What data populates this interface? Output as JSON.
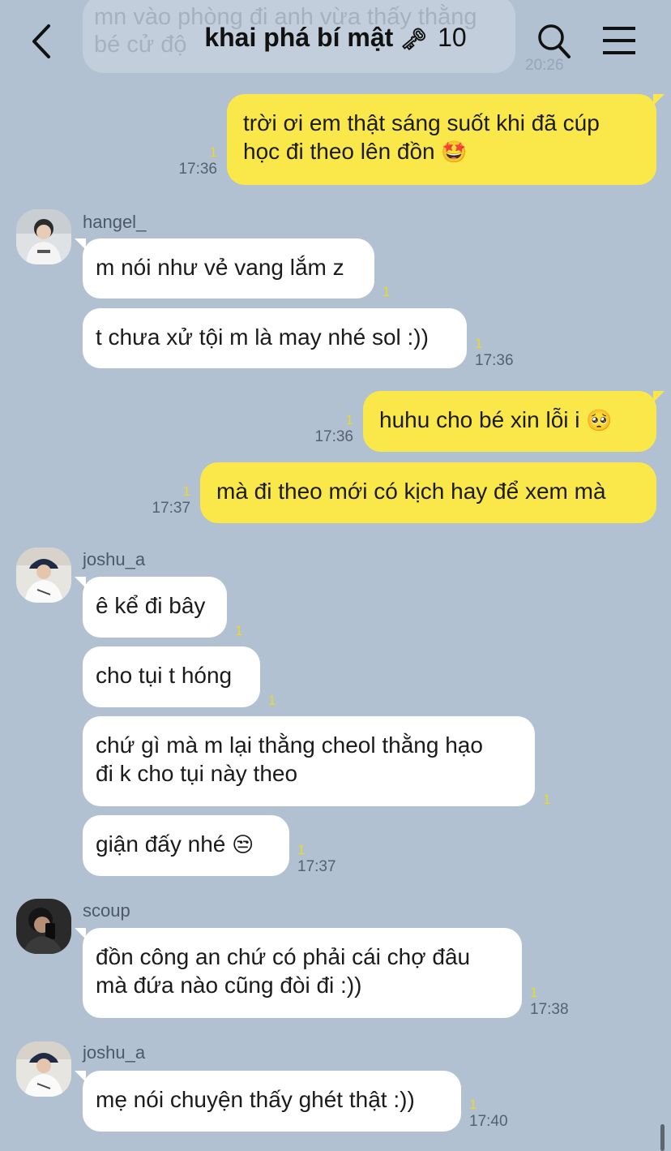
{
  "header": {
    "title": "khai phá bí mật",
    "key_emoji": "🗝",
    "member_count": "10",
    "back_icon": "chevron-left-icon",
    "search_icon": "search-icon",
    "menu_icon": "hamburger-menu-icon"
  },
  "previous_message": {
    "text": "mn vào phòng đi anh vừa thấy thằng bé cử độ",
    "time": "20:26"
  },
  "colors": {
    "background": "#b1c1d2",
    "incoming_bubble": "#ffffff",
    "outgoing_bubble": "#fae84a",
    "read_count": "#e9d928"
  },
  "messages": [
    {
      "id": "m1",
      "dir": "out",
      "line1": "trời ơi em thật sáng suốt khi đã cúp",
      "line2": "học đi theo lên đồn",
      "emoji": "🤩",
      "read": "1",
      "time": "17:36"
    },
    {
      "id": "m2",
      "dir": "in",
      "sender": "hangel_",
      "text": "m nói như vẻ vang lắm z",
      "read": "1",
      "time": ""
    },
    {
      "id": "m3",
      "dir": "in",
      "text": "t chưa xử tội m là may nhé sol :))",
      "read": "1",
      "time": "17:36"
    },
    {
      "id": "m4",
      "dir": "out",
      "text": "huhu cho bé xin lỗi i",
      "emoji": "🥺",
      "read": "1",
      "time": "17:36"
    },
    {
      "id": "m5",
      "dir": "out",
      "text": "mà đi theo mới có kịch hay để xem mà",
      "read": "1",
      "time": "17:37"
    },
    {
      "id": "m6",
      "dir": "in",
      "sender": "joshu_a",
      "text": "ê kể đi bây",
      "read": "1",
      "time": ""
    },
    {
      "id": "m7",
      "dir": "in",
      "text": "cho tụi t hóng",
      "read": "1",
      "time": ""
    },
    {
      "id": "m8",
      "dir": "in",
      "line1": "chứ gì mà m lại thằng cheol thằng hạo",
      "line2": "đi k cho tụi này theo",
      "read": "1",
      "time": ""
    },
    {
      "id": "m9",
      "dir": "in",
      "text": "giận đấy nhé",
      "emoji": "😒",
      "read": "1",
      "time": "17:37"
    },
    {
      "id": "m10",
      "dir": "in",
      "sender": "scoup",
      "line1": "đồn công an chứ có phải cái chợ đâu",
      "line2": "mà đứa nào cũng đòi đi :))",
      "read": "1",
      "time": "17:38"
    },
    {
      "id": "m11",
      "dir": "in",
      "sender": "joshu_a",
      "text": "mẹ nói chuyện thấy ghét thật :))",
      "read": "1",
      "time": "17:40"
    }
  ]
}
